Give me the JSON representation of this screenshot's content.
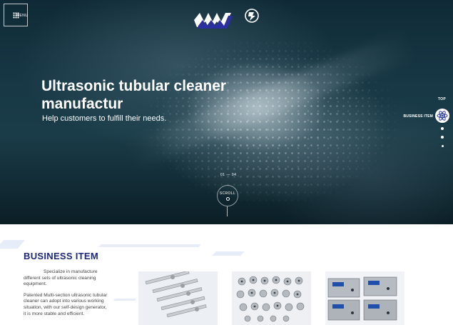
{
  "header": {
    "menu_label": "MENU"
  },
  "hero": {
    "title": "Ultrasonic tubular cleaner manufactur",
    "subtitle": "Help customers to fulfill their needs.",
    "slide_counter": "01 — 04",
    "scroll_label": "SCROLL"
  },
  "side_nav": {
    "top_label": "TOP",
    "current_label": "BUSINESS ITEM",
    "icon": "atom-icon"
  },
  "business": {
    "title": "BUSINESS ITEM",
    "paragraphs": [
      "Specialize in manufacture different sets of ultrasonic cleaning equipment.",
      "Patented Multi-section ultrasonic tubular cleaner can adopt into various working situation, with our self-design generator, it is more stable and efficient."
    ],
    "products": [
      {
        "name": "ultrasonic-tubular-transducers"
      },
      {
        "name": "ultrasonic-transducer-set"
      },
      {
        "name": "ultrasonic-generators"
      }
    ]
  },
  "colors": {
    "brand_blue": "#1d2a7a",
    "hero_dark": "#173744"
  }
}
